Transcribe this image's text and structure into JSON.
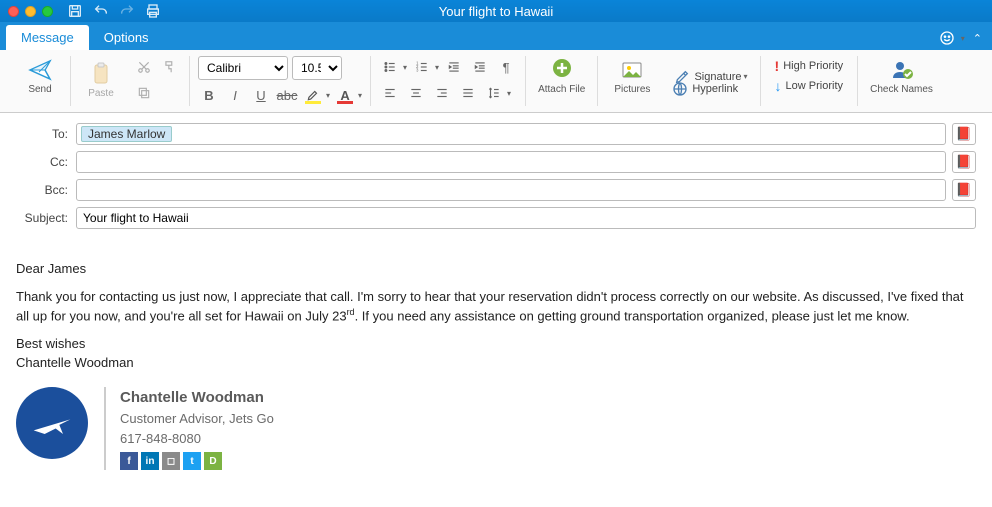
{
  "window": {
    "title": "Your flight to Hawaii"
  },
  "tabs": {
    "message": "Message",
    "options": "Options"
  },
  "ribbon": {
    "send": "Send",
    "paste": "Paste",
    "font_name": "Calibri",
    "font_size": "10.5",
    "attach_file": "Attach File",
    "pictures": "Pictures",
    "signature": "Signature",
    "hyperlink": "Hyperlink",
    "high_priority": "High Priority",
    "low_priority": "Low Priority",
    "check_names": "Check Names"
  },
  "labels": {
    "to": "To:",
    "cc": "Cc:",
    "bcc": "Bcc:",
    "subject": "Subject:"
  },
  "fields": {
    "to_recipient": "James Marlow",
    "subject": "Your flight to Hawaii"
  },
  "body": {
    "greeting": "Dear James",
    "p1a": "Thank you for contacting us just now, I appreciate that call. I'm sorry to hear that your reservation didn't process correctly on our website. As discussed, I've fixed that all up for you now, and you're all set for Hawaii on July 23",
    "p1sup": "rd",
    "p1b": ". If you need any assistance on getting ground transportation organized, please just let me know.",
    "closing": "Best wishes",
    "sender": "Chantelle Woodman"
  },
  "signature": {
    "name": "Chantelle Woodman",
    "title": "Customer Advisor, Jets Go",
    "phone": "617-848-8080"
  }
}
